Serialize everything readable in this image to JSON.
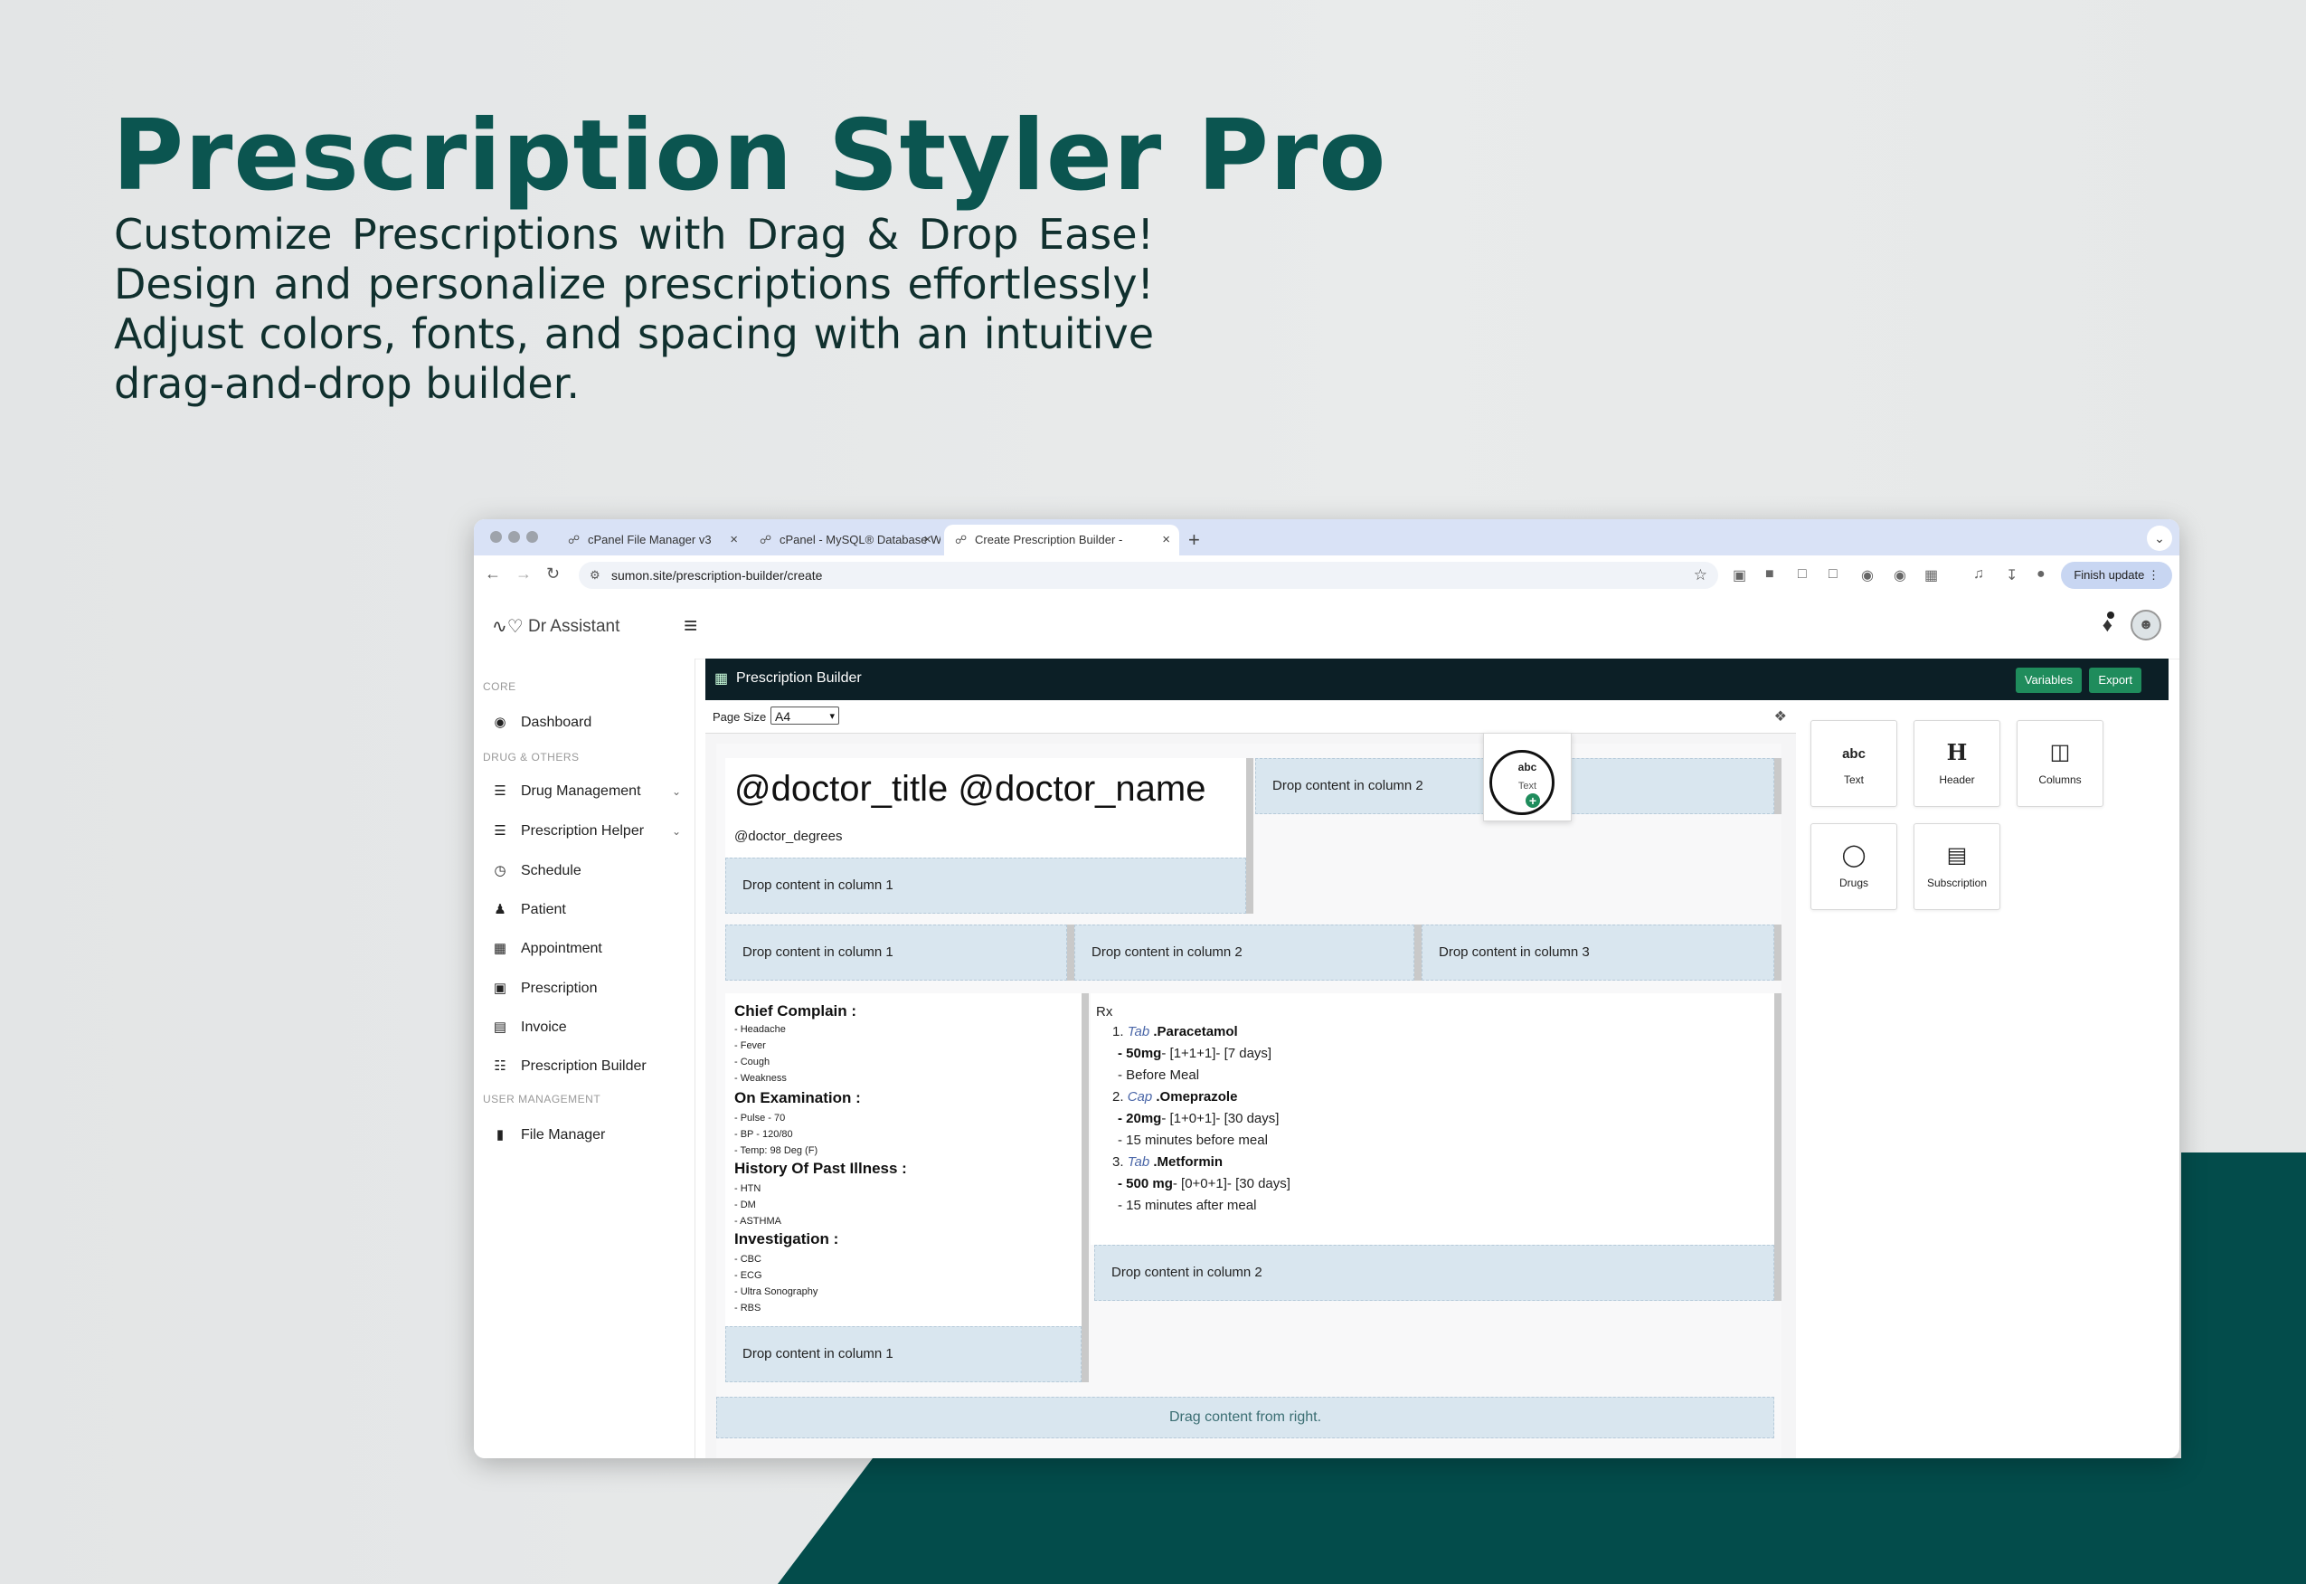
{
  "hero": {
    "title": "Prescription Styler Pro",
    "subtitle": "Customize Prescriptions with Drag & Drop Ease! Design and personalize prescriptions effortlessly! Adjust colors, fonts, and spacing with an intuitive drag-and-drop builder."
  },
  "browser": {
    "tabs": [
      {
        "label": "cPanel File Manager v3"
      },
      {
        "label": "cPanel - MySQL® Database W"
      },
      {
        "label": "Create Prescription Builder -"
      }
    ],
    "url": "sumon.site/prescription-builder/create",
    "finish_update": "Finish update"
  },
  "app": {
    "brand": "Dr Assistant",
    "sidebar": {
      "sections": [
        "CORE",
        "DRUG & OTHERS",
        "USER MANAGEMENT"
      ],
      "items": [
        {
          "label": "Dashboard",
          "icon": "dashboard-icon"
        },
        {
          "label": "Drug Management",
          "icon": "sliders-icon"
        },
        {
          "label": "Prescription Helper",
          "icon": "sliders-icon"
        },
        {
          "label": "Schedule",
          "icon": "clock-icon"
        },
        {
          "label": "Patient",
          "icon": "user-icon"
        },
        {
          "label": "Appointment",
          "icon": "calendar-icon"
        },
        {
          "label": "Prescription",
          "icon": "file-icon"
        },
        {
          "label": "Invoice",
          "icon": "invoice-icon"
        },
        {
          "label": "Prescription Builder",
          "icon": "builder-icon"
        },
        {
          "label": "File Manager",
          "icon": "folder-icon"
        }
      ]
    }
  },
  "builder": {
    "title": "Prescription Builder",
    "variables_btn": "Variables",
    "export_btn": "Export",
    "page_size_label": "Page Size",
    "page_size_value": "A4",
    "doctor_title": "@doctor_title @doctor_name",
    "doctor_degrees": "@doctor_degrees",
    "drop_col1": "Drop content in column 1",
    "drop_col2": "Drop content in column 2",
    "drop_col3": "Drop content in column 3",
    "drag_hint": "Drag content from right.",
    "sections": [
      {
        "heading": "Chief Complain :",
        "lines": [
          "- Headache",
          "- Fever",
          "- Cough",
          "- Weakness"
        ]
      },
      {
        "heading": "On Examination :",
        "lines": [
          "- Pulse - 70",
          "- BP - 120/80",
          "- Temp: 98 Deg (F)"
        ]
      },
      {
        "heading": "History Of Past Illness :",
        "lines": [
          "- HTN",
          "- DM",
          "- ASTHMA"
        ]
      },
      {
        "heading": "Investigation :",
        "lines": [
          "- CBC",
          "- ECG",
          "- Ultra Sonography",
          "- RBS"
        ]
      }
    ],
    "rx": {
      "label": "Rx",
      "items": [
        {
          "num": "1.",
          "form": "Tab",
          "name": ".Paracetamol",
          "dose": "- 50mg",
          "schedule": "- [1+1+1]- [7 days]",
          "note": "- Before Meal"
        },
        {
          "num": "2.",
          "form": "Cap",
          "name": ".Omeprazole",
          "dose": "- 20mg",
          "schedule": "- [1+0+1]- [30 days]",
          "note": "- 15 minutes before meal"
        },
        {
          "num": "3.",
          "form": "Tab",
          "name": ".Metformin",
          "dose": "- 500 mg",
          "schedule": "- [0+0+1]- [30 days]",
          "note": "- 15 minutes after meal"
        }
      ]
    },
    "tools": [
      {
        "label": "Text",
        "icon": "abc"
      },
      {
        "label": "Header",
        "icon": "H"
      },
      {
        "label": "Columns",
        "icon": "columns-icon"
      },
      {
        "label": "Drugs",
        "icon": "pills-icon"
      },
      {
        "label": "Subscription",
        "icon": "subscription-icon"
      }
    ],
    "ghost": {
      "icon": "abc",
      "label": "Text"
    }
  }
}
